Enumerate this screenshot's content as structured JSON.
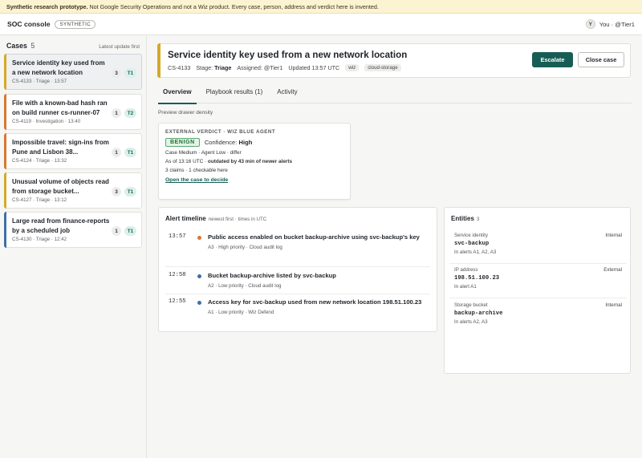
{
  "banner": {
    "bold": "Synthetic research prototype.",
    "text": " Not Google Security Operations and not a Wiz product. Every case, person, address and verdict here is invented."
  },
  "topbar": {
    "title": "SOC console",
    "pill": "SYNTHETIC",
    "avatar_initial": "Y",
    "user_label": "You · @Tier1"
  },
  "sidebar": {
    "title": "Cases",
    "count": "5",
    "sort_label": "Latest update first",
    "cases": [
      {
        "title": "Service identity key used from a new network location",
        "meta": "CS-4133 · Triage · 13:57",
        "count": "3",
        "tier": "T1",
        "color": "#d5a928"
      },
      {
        "title": "File with a known-bad hash ran on build runner cs-runner-07",
        "meta": "CS-4119 · Investigation · 13:40",
        "count": "1",
        "tier": "T2",
        "color": "#d9772f"
      },
      {
        "title": "Impossible travel: sign-ins from Pune and Lisbon 38...",
        "meta": "CS-4124 · Triage · 13:32",
        "count": "1",
        "tier": "T1",
        "color": "#d9772f"
      },
      {
        "title": "Unusual volume of objects read from storage bucket...",
        "meta": "CS-4127 · Triage · 13:12",
        "count": "3",
        "tier": "T1",
        "color": "#d5a928"
      },
      {
        "title": "Large read from finance-reports by a scheduled job",
        "meta": "CS-4130 · Triage · 12:42",
        "count": "1",
        "tier": "T1",
        "color": "#3d6fa6"
      }
    ]
  },
  "case": {
    "title": "Service identity key used from a new network location",
    "id": "CS-4133",
    "stage_label": "Stage:",
    "stage": "Triage",
    "assigned": "Assigned: @Tier1",
    "updated": "Updated 13:57 UTC",
    "tags": [
      "wiz",
      "cloud-storage"
    ],
    "escalate_label": "Escalate",
    "close_label": "Close case"
  },
  "tabs": [
    "Overview",
    "Playbook results (1)",
    "Activity"
  ],
  "preview": {
    "label": "Preview drawer density",
    "title": "EXTERNAL VERDICT · WIZ BLUE AGENT",
    "verdict": "BENIGN",
    "confidence_label": "Confidence:",
    "confidence": "High",
    "line1": "Case Medium · Agent Low · differ",
    "asof": "As of 13:16 UTC · ",
    "outdated": "outdated by 43 min of newer alerts",
    "claims": "3 claims · 1 checkable here",
    "link": "Open the case to decide"
  },
  "timeline": {
    "title": "Alert timeline",
    "subtitle": "newest first · times in UTC",
    "items": [
      {
        "time": "13:57",
        "text": "Public access enabled on bucket backup-archive using svc-backup's key",
        "meta": "A3 · High priority · Cloud audit log",
        "color": "#d9772f"
      },
      {
        "time": "12:58",
        "text": "Bucket backup-archive listed by svc-backup",
        "meta": "A2 · Low priority · Cloud audit log",
        "color": "#3d6fa6"
      },
      {
        "time": "12:55",
        "text": "Access key for svc-backup used from new network location 198.51.100.23",
        "meta": "A1 · Low priority · Wiz Defend",
        "color": "#3d6fa6"
      }
    ]
  },
  "entities": {
    "title": "Entities",
    "count": "3",
    "items": [
      {
        "type": "Service identity",
        "scope": "Internal",
        "value": "svc-backup",
        "alerts": "In alerts A1, A2, A3"
      },
      {
        "type": "IP address",
        "scope": "External",
        "value": "198.51.100.23",
        "alerts": "In alert A1"
      },
      {
        "type": "Storage bucket",
        "scope": "Internal",
        "value": "backup-archive",
        "alerts": "In alerts A2, A3"
      }
    ]
  }
}
